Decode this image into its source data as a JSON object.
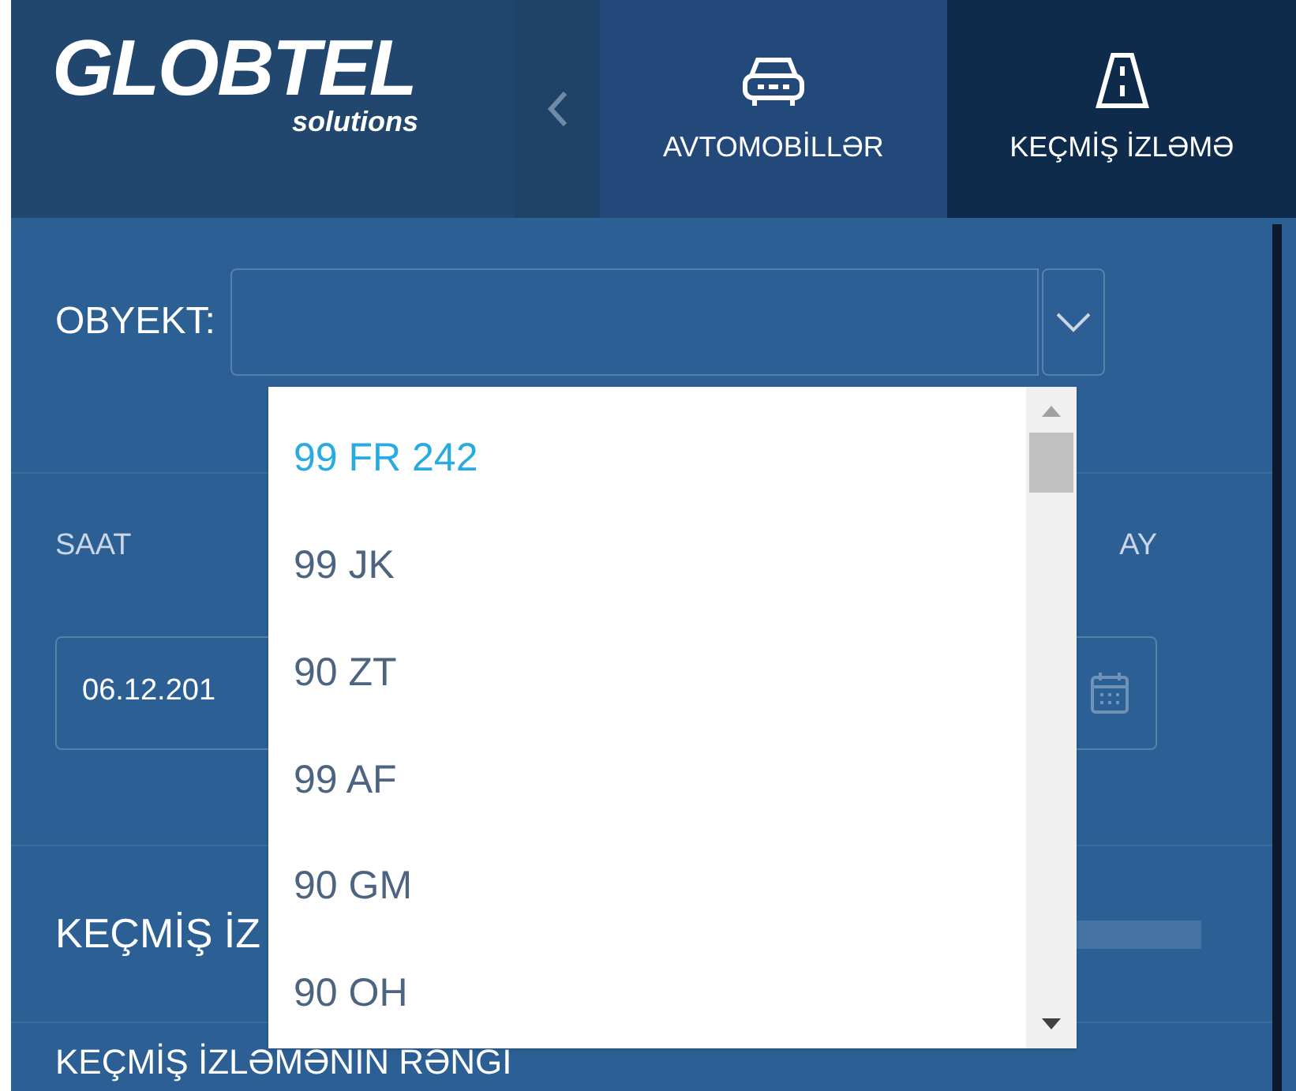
{
  "logo": {
    "name": "GLOBTEL",
    "tagline": "solutions"
  },
  "nav": {
    "tabs": [
      {
        "label": "AVTOMOBİLLƏR",
        "kind": "car",
        "selected": false
      },
      {
        "label": "KEÇMİŞ İZLƏMƏ",
        "kind": "road",
        "selected": true
      }
    ]
  },
  "form": {
    "object_label": "OBYEKT:",
    "hour_label": "SAAT",
    "month_label": "AY",
    "date_value": "06.12.201",
    "history_label": "KEÇMİŞ İZ",
    "color_label": "KEÇMİŞ İZLƏMƏNİN RƏNGİ"
  },
  "dropdown": {
    "options": [
      {
        "label": "99 FR 242",
        "selected": true
      },
      {
        "label": "99 JK",
        "selected": false
      },
      {
        "label": "90 ZT",
        "selected": false
      },
      {
        "label": "99 AF",
        "selected": false
      },
      {
        "label": "90 GM",
        "selected": false
      },
      {
        "label": "90 OH",
        "selected": false
      }
    ]
  }
}
